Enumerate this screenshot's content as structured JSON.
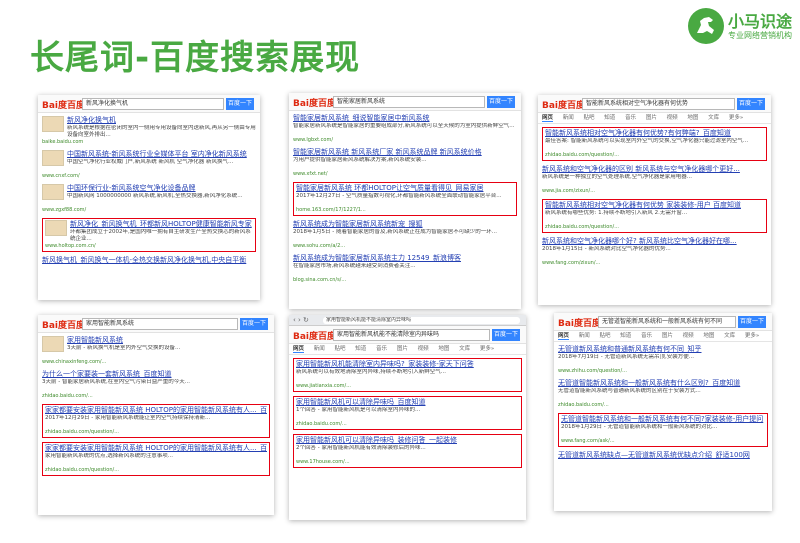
{
  "page": {
    "title": "长尾词-百度搜索展现",
    "brand": {
      "name": "小马识途",
      "slogan": "专业网络营销机构",
      "color": "#49a942"
    },
    "accent_red": "#e60012",
    "link_blue": "#2440b3",
    "url_green": "#3d8a2a"
  },
  "common": {
    "baidu_logo": "Bai度百度",
    "search_button": "百度一下",
    "tabs": [
      "网页",
      "新闻",
      "贴吧",
      "知道",
      "音乐",
      "图片",
      "视频",
      "地图",
      "文库",
      "更多»"
    ]
  },
  "screenshots": [
    {
      "query": "新风净化换气机",
      "results": [
        {
          "title": "新风净化换气机",
          "desc": "新风系统是根据在密闭的室内一侧用专用设备向室内送新风,再从另一侧由专用设备向室外排出...",
          "url": "baike.baidu.com",
          "highlighted": false,
          "thumb": true
        },
        {
          "title": "中国新风系统-新风系统行业全媒体平台 室内净化新风系统",
          "desc": "中国空气净化行业权威门户,新风系统 新风机 空气净化器 新风换气...",
          "url": "www.cnxf.com/",
          "highlighted": false,
          "thumb": true
        },
        {
          "title": "中国环保行业-新风系统空气净化设备品牌",
          "desc": "中国新风网 1000000000 新风系统,新风机,全热交换器,新风净化系统...",
          "url": "www.zgxf88.com/",
          "highlighted": false,
          "thumb": true
        },
        {
          "title": "新风净化_新风换气机_环都新风HOLTOP健康智能新风专家",
          "desc": "环都集团成立于2002年,是国内唯一拥有自主研发生产全热交换芯的新风系统企业...",
          "url": "www.holtop.com.cn/",
          "highlighted": true,
          "thumb": true
        },
        {
          "title": "新风换气机_新风换气一体机-全热交换新风净化换气机,中央自平衡",
          "desc": "",
          "url": "",
          "highlighted": false,
          "thumb": false
        }
      ]
    },
    {
      "query": "智能家居新风系统",
      "results": [
        {
          "title": "智能家居新风系统_细说智能家居中新风系统",
          "desc": "智能家居新风系统是智能家居的重要组成部分,新风系统可以全天候的为室内提供新鲜空气...",
          "url": "www.lgbxt.com/",
          "highlighted": false,
          "thumb": false
        },
        {
          "title": "智能家居新风系统 新风系统厂家 新风系统品牌 新风系统价格",
          "desc": "为用户提供智能家居新风系统解决方案,新风系统安装...",
          "url": "www.xfxt.net/",
          "highlighted": false,
          "thumb": false
        },
        {
          "title": "智能家居新风系统 环都HOLTOP让空气质量看得见_网易家居",
          "desc": "2017年12月27日 - 空气质量指数可视化,环都智能新风系统全面联动智能家居平台...",
          "url": "home.163.com/17/1227/1...",
          "highlighted": true,
          "thumb": false
        },
        {
          "title": "新风系统成为智能家居新风系统新宠_搜狐",
          "desc": "2018年1月5日 - 随着智能家居的普及,新风系统正在成为智能家居不可缺少的一环...",
          "url": "www.sohu.com/a/2...",
          "highlighted": false,
          "thumb": false
        },
        {
          "title": "新风系统成为智能家居新风系统主力 12549_新浪博客",
          "desc": "在智能家居市场,新风系统越来越受到消费者关注...",
          "url": "blog.sina.com.cn/s/...",
          "highlighted": false,
          "thumb": false
        }
      ]
    },
    {
      "query": "智能新风系统相对空气净化器有何优势",
      "results": [
        {
          "title": "智能新风系统相对空气净化器有何优势?有何弊端?_百度知道",
          "desc": "最佳答案: 智能新风系统可以实现室内外空气的交换,空气净化器只能过滤室内空气...",
          "url": "zhidao.baidu.com/question/...",
          "highlighted": true,
          "thumb": false
        },
        {
          "title": "新风系统和空气净化器的区别 新风系统与空气净化器哪个更好...",
          "desc": "新风系统是一种独立的空气处理系统,空气净化器是家用电器...",
          "url": "www.jia.com/zixun/...",
          "highlighted": false,
          "thumb": false
        },
        {
          "title": "智能新风系统相对空气净化器有何优势 家装装修-用户 百度知道",
          "desc": "新风系统有哪些优势: 1.持续不断地引入新风 2.无需开窗...",
          "url": "zhidao.baidu.com/question/...",
          "highlighted": true,
          "thumb": false
        },
        {
          "title": "新风系统和空气净化器哪个好? 新风系统比空气净化器好在哪...",
          "desc": "2018年1月15日 - 新风系统对比空气净化器的优势...",
          "url": "www.fang.com/zixun/...",
          "highlighted": false,
          "thumb": false
        }
      ]
    },
    {
      "query": "家用智能新风系统",
      "results": [
        {
          "title": "家用智能新风系统",
          "desc": "3天前 - 新风换气机是室内外空气交换的设备...",
          "url": "www.chinaxinfeng.com/...",
          "highlighted": false,
          "thumb": true
        },
        {
          "title": "为什么一个家要装一套新风系统_百度知道",
          "desc": "3天前 - 智能家居新风系统,在室内空气污染日益严重的今天...",
          "url": "zhidao.baidu.com/...",
          "highlighted": false,
          "thumb": false
        },
        {
          "title": "家家都要安装家用智能新风系统 HOLTOP的家用智能新风系统有人..._百度知道",
          "desc": "2017年12月29日 - 家用智能新风系统能让室内空气持续保持清新...",
          "url": "zhidao.baidu.com/question/...",
          "highlighted": true,
          "thumb": false
        },
        {
          "title": "家家都要安装家用智能新风系统 HOLTOP的家用智能新风系统有人..._百度知道",
          "desc": "家用智能新风系统的优点,选择新风系统的注意事项...",
          "url": "zhidao.baidu.com/question/...",
          "highlighted": true,
          "thumb": false
        }
      ]
    },
    {
      "query": "家用智能新风机能不能清除室内异味吗",
      "url_bar": "家用智能新风机能不能清除室内异味吗",
      "results": [
        {
          "title": "家用智能新风机能清除室内异味吗?_家装装修-家天下问答",
          "desc": "新风系统可以有效地清除室内异味,持续不断地引入新鲜空气...",
          "url": "www.jiatianxia.com/...",
          "highlighted": true,
          "thumb": false
        },
        {
          "title": "家用智能新风机可以清除异味吗_百度知道",
          "desc": "1个回答 - 家用智能新风机是可以清除室内异味的...",
          "url": "zhidao.baidu.com/...",
          "highlighted": true,
          "thumb": false
        },
        {
          "title": "家用智能新风机可以清除异味吗_装修问答_一起装修",
          "desc": "2个回答 - 家用智能新风机能有效清除装修后的异味...",
          "url": "www.17house.com/...",
          "highlighted": true,
          "thumb": false
        }
      ]
    },
    {
      "query": "无管道智能新风系统和一般新风系统有何不同",
      "results": [
        {
          "title": "无管道新风系统和普通新风系统有何不同_知乎",
          "desc": "2018年7月19日 - 无管道新风系统无需吊顶,安装方便...",
          "url": "www.zhihu.com/question/...",
          "highlighted": false,
          "thumb": false
        },
        {
          "title": "无管道智能新风系统和一般新风系统有什么区别?_百度知道",
          "desc": "无管道智能新风系统与普通新风系统的区别在于安装方式...",
          "url": "zhidao.baidu.com/...",
          "highlighted": false,
          "thumb": false
        },
        {
          "title": "无管道智能新风系统和一般新风系统有何不同?家装装修-用户提问",
          "desc": "2018年1月29日 - 无管道智能新风系统和一般新风系统的对比...",
          "url": "www.fang.com/ask/...",
          "highlighted": true,
          "thumb": false
        },
        {
          "title": "无管道新风系统缺点—无管道新风系统优缺点介绍_舒适100网",
          "desc": "",
          "url": "",
          "highlighted": false,
          "thumb": false
        }
      ]
    }
  ]
}
